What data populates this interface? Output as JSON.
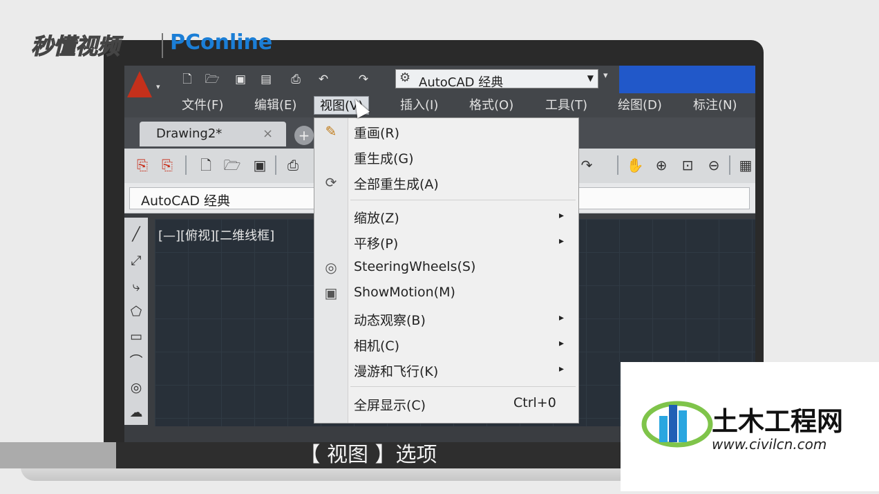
{
  "watermarks": {
    "left": "秒懂视频",
    "right": "PConline"
  },
  "qat": {
    "workspace": "AutoCAD 经典",
    "icons": [
      "new-icon",
      "open-icon",
      "save-icon",
      "save-as-icon",
      "print-icon",
      "undo-icon",
      "redo-icon"
    ]
  },
  "menubar": {
    "items": [
      "文件(F)",
      "编辑(E)",
      "视图(V)",
      "插入(I)",
      "格式(O)",
      "工具(T)",
      "绘图(D)",
      "标注(N)"
    ],
    "active_index": 2
  },
  "tabs": {
    "doc": "Drawing2*",
    "close": "×",
    "new": "+"
  },
  "workspace_toolbar": {
    "value": "AutoCAD 经典"
  },
  "viewport": {
    "label": "[—][俯视][二维线框]"
  },
  "view_menu": {
    "items": [
      {
        "label": "重画(R)",
        "icon": "redraw-icon"
      },
      {
        "label": "重生成(G)"
      },
      {
        "label": "全部重生成(A)",
        "icon": "regen-all-icon"
      },
      {
        "label": "缩放(Z)",
        "submenu": "▸"
      },
      {
        "label": "平移(P)",
        "submenu": "▸"
      },
      {
        "label": "SteeringWheels(S)",
        "icon": "steeringwheels-icon"
      },
      {
        "label": "ShowMotion(M)",
        "icon": "showmotion-icon"
      },
      {
        "label": "动态观察(B)",
        "submenu": "▸"
      },
      {
        "label": "相机(C)",
        "submenu": "▸"
      },
      {
        "label": "漫游和飞行(K)",
        "submenu": "▸"
      },
      {
        "label": "全屏显示(C)",
        "shortcut": "Ctrl+0"
      }
    ]
  },
  "subtitle": "【 视图 】选项",
  "brand": {
    "name": "土木工程网",
    "url": "www.civilcn.com",
    "colors": [
      "#1f5fb5",
      "#2aa6e0",
      "#7fc44a"
    ]
  }
}
